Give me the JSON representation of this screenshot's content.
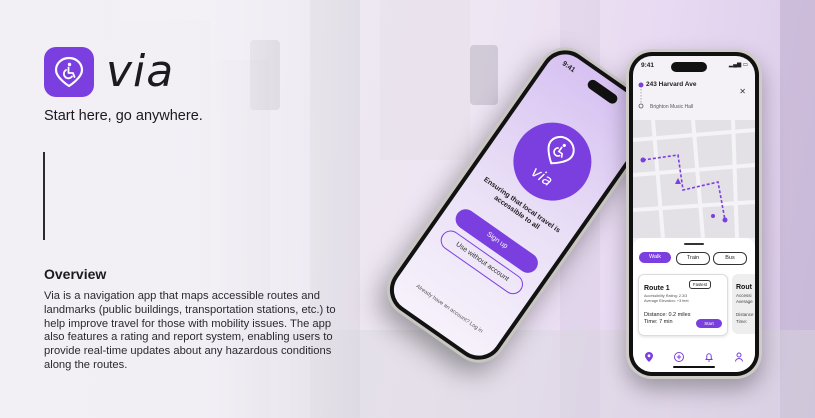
{
  "brand": {
    "name": "via",
    "tagline": "Start here, go anywhere.",
    "accent_color": "#7b3fe0",
    "logo_icon": "wheelchair-location-pin-icon"
  },
  "overview": {
    "title": "Overview",
    "body": "Via is a navigation app that maps accessible routes and landmarks (public buildings, transportation stations, etc.) to help improve travel for those with mobility issues. The app also features a rating and report system, enabling users to provide real-time updates about any hazardous conditions along the routes."
  },
  "phone_welcome": {
    "time": "9:41",
    "app_name": "via",
    "message": "Ensuring that local travel is accessible to all",
    "signup_label": "Sign up",
    "no_account_label": "Use without account",
    "login_prompt": "Already have an account? Log in"
  },
  "phone_route": {
    "time": "9:41",
    "destination": "243 Harvard Ave",
    "origin": "Brighton Music Hall",
    "modes": [
      "Walk",
      "Train",
      "Bus"
    ],
    "active_mode": "Walk",
    "route_card": {
      "title": "Route 1",
      "badge": "Fastest",
      "accessibility_rating": "Accessibility Rating: 2.3/3",
      "average_elevation": "Average Elevation: +3 feet",
      "distance": "Distance: 0.2 miles",
      "time": "Time: 7 min",
      "start_label": "Start"
    },
    "route_card_2": {
      "title": "Rout",
      "meta": "Accessi",
      "meta2": "Average",
      "distance": "Distance",
      "time": "Time:"
    },
    "nav_icons": [
      "map-pin-icon",
      "plus-circle-icon",
      "bell-icon",
      "user-icon"
    ]
  }
}
